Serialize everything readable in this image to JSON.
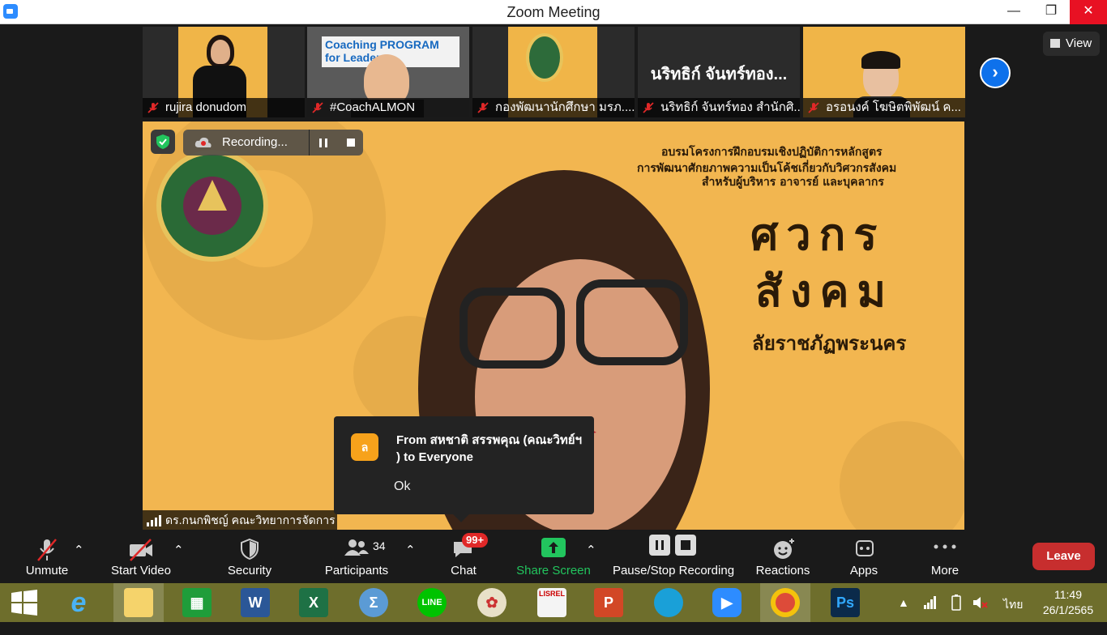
{
  "window": {
    "title": "Zoom Meeting"
  },
  "gallery": {
    "thumbs": [
      {
        "caption": "rujira donudom"
      },
      {
        "caption": "#CoachALMON",
        "banner": "Coaching PROGRAM for Leader"
      },
      {
        "caption": "กองพัฒนานักศึกษา มรภ...."
      },
      {
        "caption": "นริทธิก์ จันทร์ทอง สำนักศิ...",
        "big_name": "นริทธิก์ จันทร์ทอง..."
      },
      {
        "caption": "อรอนงค์ โฆษิตพิพัฒน์ ค..."
      }
    ],
    "view_label": "View"
  },
  "main": {
    "recording_label": "Recording...",
    "speaker_name": "ดร.กนกพิชญ์ คณะวิทยาการจัดการ",
    "slide": {
      "line1": "อบรมโครงการฝึกอบรมเชิงปฏิบัติการหลักสูตร",
      "line2": "การพัฒนาศักยภาพความเป็นโค้ชเกี่ยวกับวิศวกรสังคม",
      "line3": "สำหรับผู้บริหาร อาจารย์ และบุคลากร",
      "big1": "ศวกร",
      "big2": "สังคม",
      "line4": "ลัยราชภัฏพระนคร"
    }
  },
  "notification": {
    "avatar_letter": "ล",
    "message": "From สหชาติ สรรพคุณ (คณะวิทย์ฯ ) to Everyone",
    "ok_label": "Ok"
  },
  "toolbar": {
    "unmute": "Unmute",
    "start_video": "Start Video",
    "security": "Security",
    "participants": "Participants",
    "participants_count": "34",
    "chat": "Chat",
    "chat_badge": "99+",
    "share_screen": "Share Screen",
    "pause_stop_recording": "Pause/Stop Recording",
    "reactions": "Reactions",
    "apps": "Apps",
    "more": "More",
    "leave": "Leave",
    "colors": {
      "share": "#22c55e",
      "leave": "#c72e2e",
      "accent": "#0e71eb"
    }
  },
  "taskbar": {
    "items": [
      "start-icon",
      "internet-explorer-icon",
      "file-explorer-icon",
      "store-icon",
      "word-icon",
      "excel-icon",
      "calculator-icon",
      "line-icon",
      "paint-icon",
      "lisrel-icon",
      "powerpoint-icon",
      "edge-icon",
      "zoom-icon",
      "chrome-icon",
      "photoshop-icon"
    ],
    "labels": {
      "word": "W",
      "excel": "X",
      "powerpoint": "P",
      "photoshop": "Ps",
      "line": "LINE",
      "lisrel": "LISREL"
    },
    "language": "ไทย",
    "time": "11:49",
    "date": "26/1/2565"
  }
}
